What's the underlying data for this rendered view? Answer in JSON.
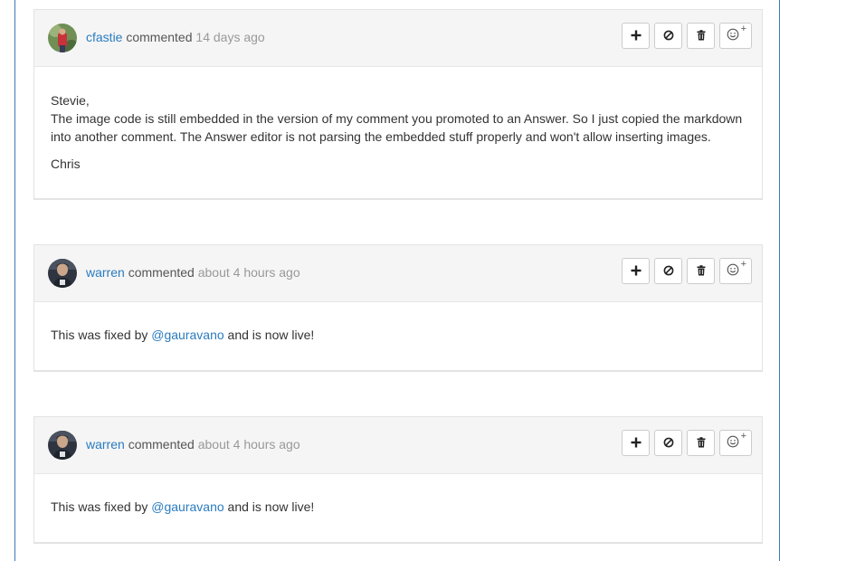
{
  "comments": [
    {
      "author": "cfastie",
      "verb": "commented",
      "time": "14 days ago",
      "body": {
        "greeting": "Stevie,",
        "line1": "The image code is still embedded in the version of my comment you promoted to an Answer. So I just copied the markdown into another comment. The Answer editor is not parsing the embedded stuff properly and won't allow inserting images.",
        "signoff": "Chris"
      }
    },
    {
      "author": "warren",
      "verb": "commented",
      "time": "about 4 hours ago",
      "body": {
        "before": "This was fixed by ",
        "mention": "@gauravano",
        "after": " and is now live!"
      }
    },
    {
      "author": "warren",
      "verb": "commented",
      "time": "about 4 hours ago",
      "body": {
        "before": "This was fixed by ",
        "mention": "@gauravano",
        "after": " and is now live!"
      }
    }
  ],
  "buttons": {
    "emoji_plus": "+"
  },
  "icons": [
    "plus-icon",
    "ban-icon",
    "trash-icon",
    "smiley-icon"
  ]
}
